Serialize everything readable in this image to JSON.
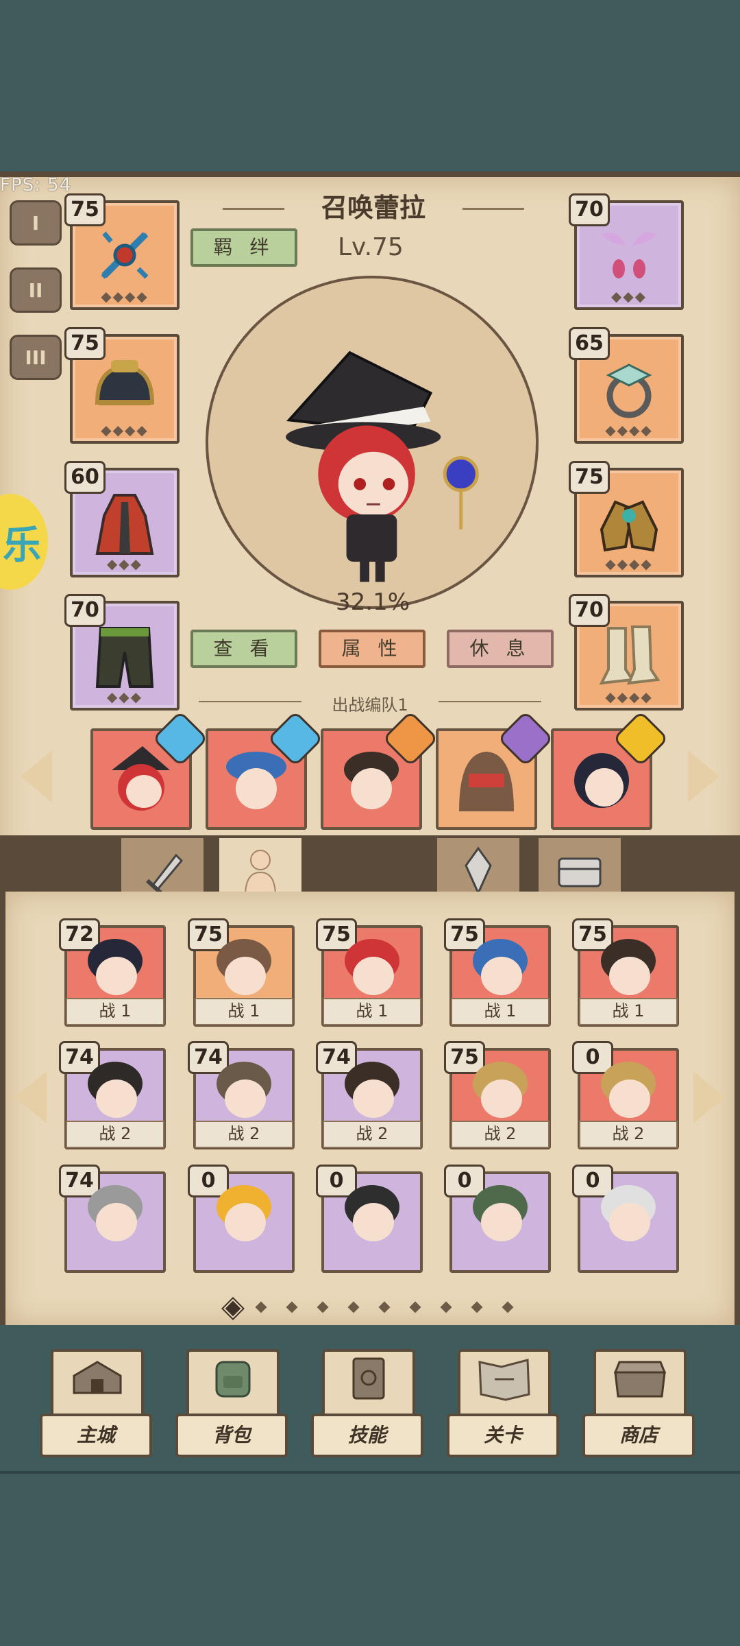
{
  "fps": "FPS: 54",
  "character": {
    "name": "召唤蕾拉",
    "level": "Lv.75",
    "exp_percent": "32.1%",
    "bond_label": "羁 绊",
    "view_label": "查 看",
    "attr_label": "属 性",
    "rest_label": "休 息"
  },
  "ranks": [
    "I",
    "II",
    "III"
  ],
  "side_coin_text": "乐",
  "equipment_left": [
    {
      "level": "75",
      "name": "staff",
      "rarity": "orange"
    },
    {
      "level": "75",
      "name": "helmet",
      "rarity": "orange"
    },
    {
      "level": "60",
      "name": "robe",
      "rarity": "purple"
    },
    {
      "level": "70",
      "name": "pants",
      "rarity": "purple"
    }
  ],
  "equipment_right": [
    {
      "level": "70",
      "name": "earrings",
      "rarity": "purple"
    },
    {
      "level": "65",
      "name": "ring",
      "rarity": "orange"
    },
    {
      "level": "75",
      "name": "gloves",
      "rarity": "orange"
    },
    {
      "level": "70",
      "name": "boots",
      "rarity": "orange"
    }
  ],
  "team": {
    "label": "出战编队1",
    "members": [
      {
        "name": "witch",
        "card": "red",
        "badge": "blue"
      },
      {
        "name": "blue-cap",
        "card": "red",
        "badge": "blue"
      },
      {
        "name": "circlet-boy",
        "card": "red",
        "badge": "orange"
      },
      {
        "name": "hooded",
        "card": "orange",
        "badge": "purple"
      },
      {
        "name": "dark-hair-girl",
        "card": "red",
        "badge": "yellow"
      }
    ]
  },
  "heroes": [
    {
      "level": "72",
      "tag": "战 1",
      "card": "red"
    },
    {
      "level": "75",
      "tag": "战 1",
      "card": "orange"
    },
    {
      "level": "75",
      "tag": "战 1",
      "card": "red"
    },
    {
      "level": "75",
      "tag": "战 1",
      "card": "red"
    },
    {
      "level": "75",
      "tag": "战 1",
      "card": "red"
    },
    {
      "level": "74",
      "tag": "战 2",
      "card": "purple"
    },
    {
      "level": "74",
      "tag": "战 2",
      "card": "purple"
    },
    {
      "level": "74",
      "tag": "战 2",
      "card": "purple"
    },
    {
      "level": "75",
      "tag": "战 2",
      "card": "red"
    },
    {
      "level": "0",
      "tag": "战 2",
      "card": "red"
    },
    {
      "level": "74",
      "tag": "",
      "card": "purple"
    },
    {
      "level": "0",
      "tag": "",
      "card": "purple"
    },
    {
      "level": "0",
      "tag": "",
      "card": "purple"
    },
    {
      "level": "0",
      "tag": "",
      "card": "purple"
    },
    {
      "level": "0",
      "tag": "",
      "card": "purple"
    }
  ],
  "page_dots": 10,
  "active_page": 1,
  "nav": [
    {
      "label": "主城",
      "icon": "house-icon"
    },
    {
      "label": "背包",
      "icon": "backpack-icon"
    },
    {
      "label": "技能",
      "icon": "skill-book-icon"
    },
    {
      "label": "关卡",
      "icon": "map-icon"
    },
    {
      "label": "商店",
      "icon": "shop-icon"
    }
  ],
  "colors": {
    "parchment": "#e8d7b8",
    "teal": "#3f5b5c",
    "card_red": "#ec7a6a",
    "card_orange": "#f1ae78",
    "card_purple": "#cfb4de"
  }
}
